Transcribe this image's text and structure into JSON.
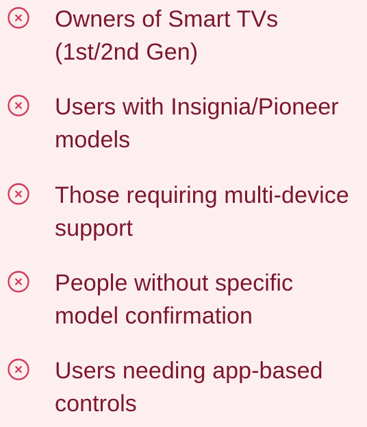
{
  "items": [
    {
      "icon": "x-circle-icon",
      "label": "Owners of Smart TVs (1st/2nd Gen)"
    },
    {
      "icon": "x-circle-icon",
      "label": "Users with Insignia/Pioneer models"
    },
    {
      "icon": "x-circle-icon",
      "label": "Those requiring multi-device support"
    },
    {
      "icon": "x-circle-icon",
      "label": "People without specific model confirmation"
    },
    {
      "icon": "x-circle-icon",
      "label": "Users needing app-based controls"
    }
  ],
  "colors": {
    "background": "#fdefef",
    "text": "#7b1730",
    "icon": "#d13b5a"
  }
}
